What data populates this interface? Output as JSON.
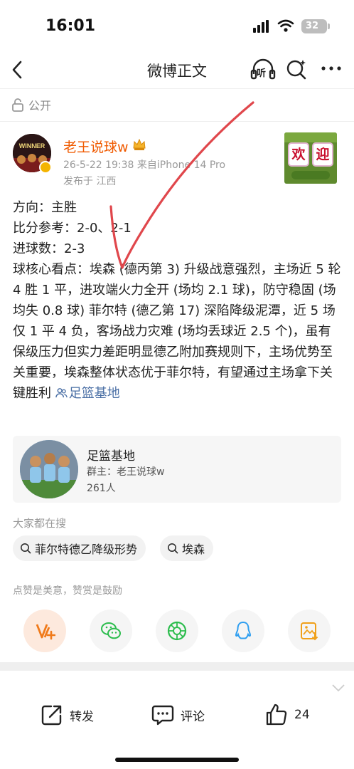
{
  "status_bar": {
    "time": "16:01",
    "battery": "32"
  },
  "nav": {
    "title": "微博正文",
    "listen_label": "听"
  },
  "visibility": {
    "label": "公开"
  },
  "author": {
    "avatar_text": "WINNER",
    "name": "老王说球w",
    "meta": "26-5-22 19:38  来自iPhone 14 Pro",
    "location": "发布于 江西",
    "sticker_chars": [
      "欢",
      "迎"
    ]
  },
  "post": {
    "line1": "方向：主胜",
    "line2": "比分参考：2-0、2-1",
    "line3": "进球数：2-3",
    "body": "球核心看点：埃森 (德丙第 3) 升级战意强烈，主场近 5 轮 4 胜 1 平，进攻端火力全开 (场均 2.1 球)，防守稳固 (场均失 0.8 球) 菲尔特 (德乙第 17) 深陷降级泥潭，近 5 场仅 1 平 4 负，客场战力灾难 (场均丢球近 2.5 个)，虽有保级压力但实力差距明显德乙附加赛规则下，主场优势至关重要，埃森整体状态优于菲尔特，有望通过主场拿下关键胜利 ",
    "link": "足篮基地"
  },
  "group_card": {
    "name": "足篮基地",
    "owner": "群主：老王说球w",
    "members": "261人"
  },
  "search": {
    "heading": "大家都在搜",
    "chips": [
      "菲尔特德乙降级形势",
      "埃森"
    ]
  },
  "reward": {
    "text": "点赞是美意，赞赏是鼓励"
  },
  "share_targets": [
    "reward-icon",
    "wechat-icon",
    "moments-icon",
    "qq-icon",
    "save-image-icon"
  ],
  "actions": {
    "repost": "转发",
    "comment": "评论",
    "like_count": "24"
  },
  "colors": {
    "accent": "#f05a00",
    "link": "#4a6fa5",
    "annotation": "#e0474c"
  }
}
